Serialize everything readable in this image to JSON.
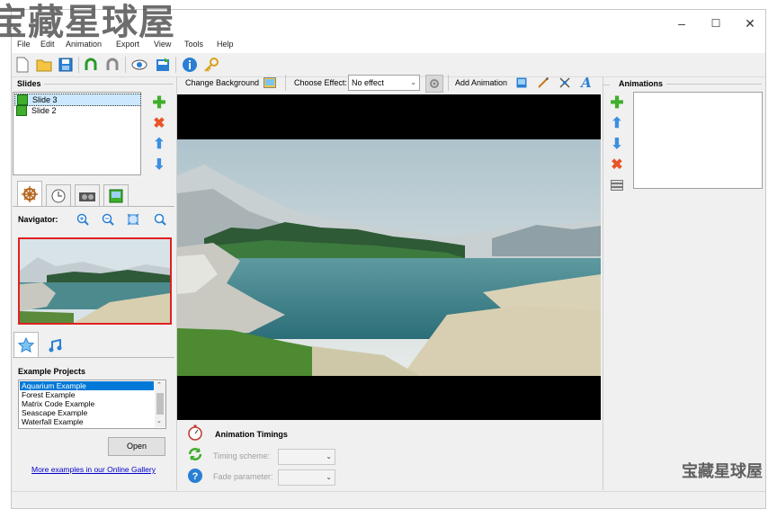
{
  "watermark": {
    "top": "宝藏星球屋",
    "bottom": "宝藏星球屋"
  },
  "window": {
    "minimize": "–",
    "maximize": "☐",
    "close": "✕"
  },
  "menu": [
    "File",
    "Edit",
    "Animation",
    "Export",
    "View",
    "Tools",
    "Help"
  ],
  "toolbar": {
    "icons": [
      "new-file-icon",
      "open-folder-icon",
      "save-icon",
      "undo-icon",
      "redo-icon",
      "preview-eye-icon",
      "export-icon",
      "info-icon",
      "key-icon"
    ],
    "change_background": "Change Background",
    "choose_effect_label": "Choose Effect:",
    "effect_value": "No effect",
    "add_animation": "Add Animation"
  },
  "slides": {
    "header": "Slides",
    "items": [
      "Slide 3",
      "Slide 2"
    ],
    "selected": 0
  },
  "navigator": {
    "label": "Navigator:"
  },
  "tabs_top": [
    "navigator-tab",
    "clock-tab",
    "camera-tab",
    "image-tab"
  ],
  "tabs_bottom": [
    "star-tab",
    "music-tab"
  ],
  "examples": {
    "header": "Example Projects",
    "items": [
      "Aquarium Example",
      "Forest Example",
      "Matrix Code Example",
      "Seascape Example",
      "Waterfall Example"
    ],
    "selected": 0,
    "open": "Open",
    "gallery_link": "More examples in our Online Gallery"
  },
  "timings": {
    "header": "Animation Timings",
    "scheme_label": "Timing scheme:",
    "fade_label": "Fade parameter:"
  },
  "animations": {
    "header": "Animations"
  },
  "colors": {
    "accent": "#0078d7",
    "selection": "#cce8ff",
    "nav_border": "#e02020",
    "green": "#3fae2a",
    "red": "#e8542a",
    "blue": "#3b8fe0"
  }
}
